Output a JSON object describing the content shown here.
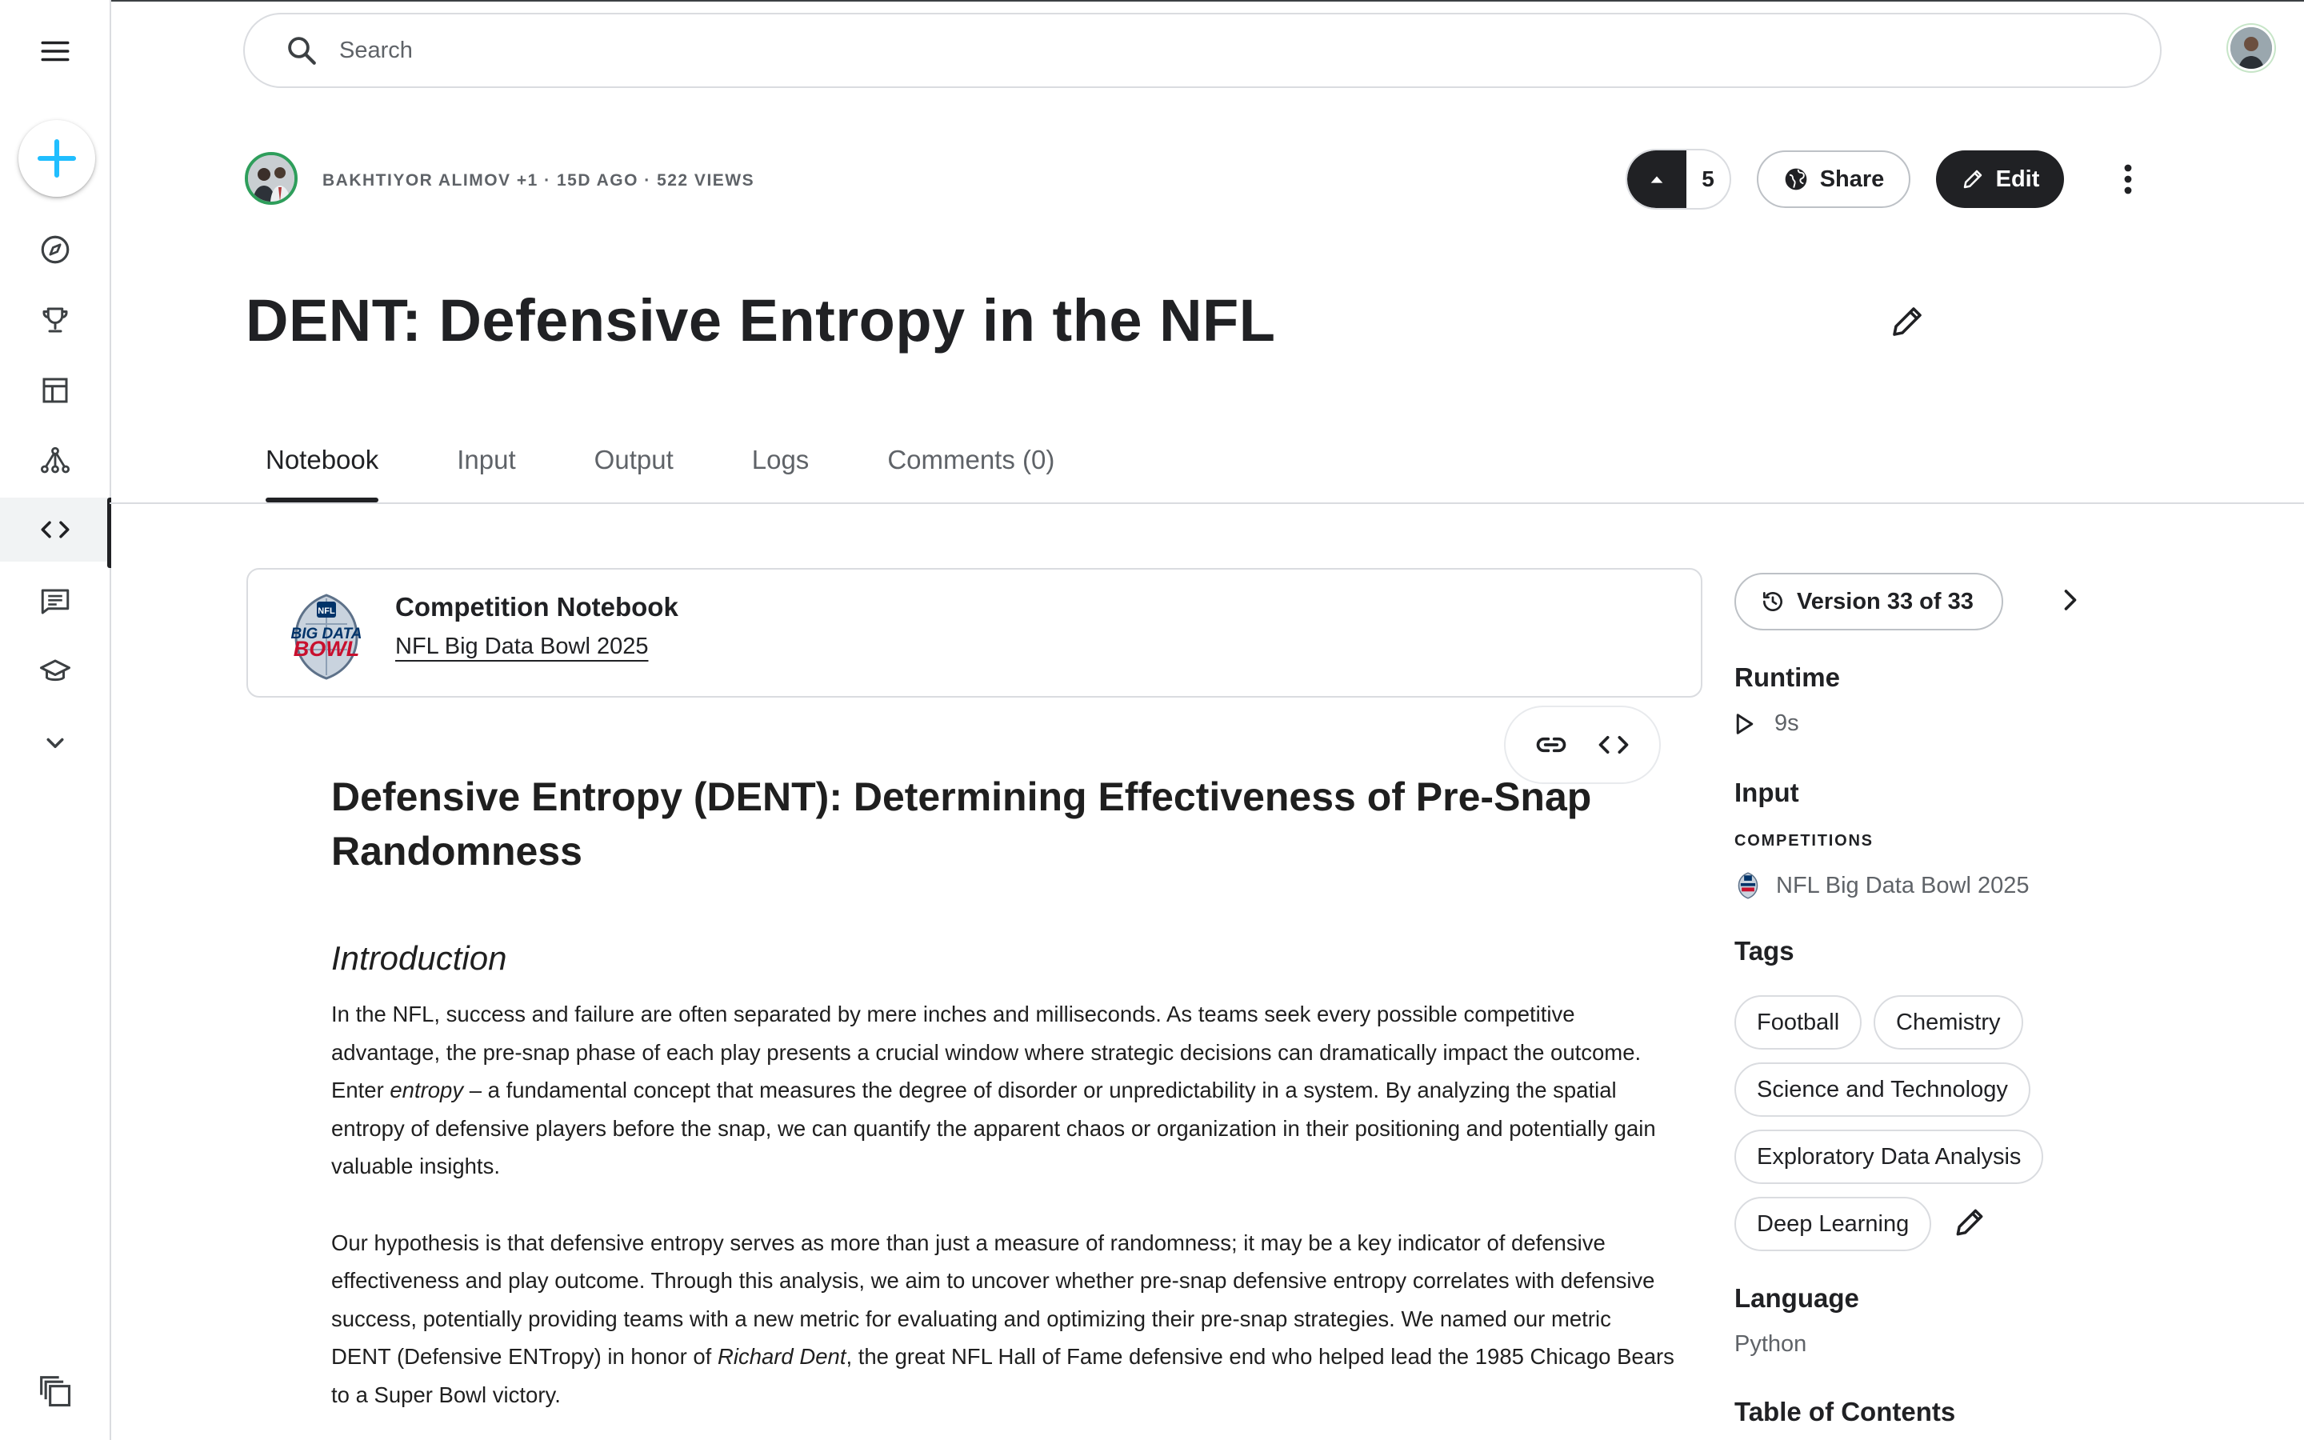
{
  "search": {
    "placeholder": "Search"
  },
  "meta": {
    "byline": "BAKHTIYOR ALIMOV +1 · 15D AGO · 522 VIEWS"
  },
  "actions": {
    "upvotes": "5",
    "share_label": "Share",
    "edit_label": "Edit"
  },
  "notebook_title": "DENT: Defensive Entropy in the NFL",
  "tabs": [
    {
      "label": "Notebook"
    },
    {
      "label": "Input"
    },
    {
      "label": "Output"
    },
    {
      "label": "Logs"
    },
    {
      "label": "Comments (0)"
    }
  ],
  "competition": {
    "kicker": "Competition Notebook",
    "name": "NFL Big Data Bowl 2025",
    "logo_text_1": "BIG DATA",
    "logo_text_2": "BOWL",
    "logo_text_nfl": "NFL"
  },
  "content": {
    "heading": "Defensive Entropy (DENT): Determining Effectiveness of Pre-Snap Randomness",
    "subheading": "Introduction",
    "p1_a": "In the NFL, success and failure are often separated by mere inches and milliseconds. As teams seek every possible competitive advantage, the pre-snap phase of each play presents a crucial window where strategic decisions can dramatically impact the outcome. Enter ",
    "p1_em": "entropy",
    "p1_b": " – a fundamental concept that measures the degree of disorder or unpredictability in a system. By analyzing the spatial entropy of defensive players before the snap, we can quantify the apparent chaos or organization in their positioning and potentially gain valuable insights.",
    "p2_a": "Our hypothesis is that defensive entropy serves as more than just a measure of randomness; it may be a key indicator of defensive effectiveness and play outcome. Through this analysis, we aim to uncover whether pre-snap defensive entropy correlates with defensive success, potentially providing teams with a new metric for evaluating and optimizing their pre-snap strategies. We named our metric DENT (Defensive ENTropy) in honor of ",
    "p2_em": "Richard Dent",
    "p2_b": ", the great NFL Hall of Fame defensive end who helped lead the 1985 Chicago Bears to a Super Bowl victory."
  },
  "sidebar_panel": {
    "version": "Version 33 of 33",
    "runtime_heading": "Runtime",
    "runtime_value": "9s",
    "input_heading": "Input",
    "input_sub": "COMPETITIONS",
    "input_item": "NFL Big Data Bowl 2025",
    "tags_heading": "Tags",
    "tags": [
      {
        "label": "Football"
      },
      {
        "label": "Chemistry"
      },
      {
        "label": "Science and Technology"
      },
      {
        "label": "Exploratory Data Analysis"
      },
      {
        "label": "Deep Learning"
      }
    ],
    "language_heading": "Language",
    "language_value": "Python",
    "toc_heading": "Table of Contents"
  },
  "nav": {
    "items": [
      {
        "icon": "menu-icon"
      },
      {
        "icon": "create-icon"
      },
      {
        "icon": "compass-icon"
      },
      {
        "icon": "trophy-icon"
      },
      {
        "icon": "table-icon"
      },
      {
        "icon": "models-icon"
      },
      {
        "icon": "code-icon"
      },
      {
        "icon": "discussion-icon"
      },
      {
        "icon": "learn-icon"
      },
      {
        "icon": "chevron-down-icon"
      },
      {
        "icon": "recent-items-icon"
      }
    ]
  },
  "colors": {
    "accent_blue": "#20beff",
    "dark": "#202124",
    "muted": "#5f6368",
    "border": "#dadce0",
    "author_ring": "#2e9e5b"
  }
}
